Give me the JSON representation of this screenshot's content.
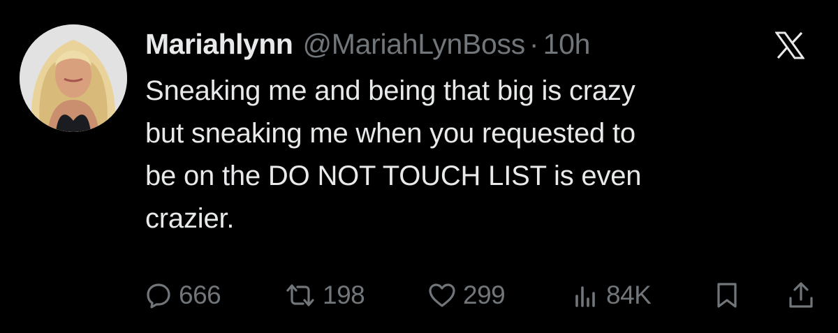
{
  "tweet": {
    "display_name": "Mariahlynn",
    "handle": "@MariahLynBoss",
    "separator": "·",
    "timestamp": "10h",
    "text_lines": [
      "Sneaking me and being that big is crazy",
      "but sneaking me when you requested to",
      "be on the DO NOT TOUCH LIST is even",
      "crazier."
    ]
  },
  "metrics": {
    "replies": "666",
    "reposts": "198",
    "likes": "299",
    "views": "84K"
  },
  "icons": {
    "brand": "x-logo-icon",
    "reply": "reply-icon",
    "repost": "repost-icon",
    "like": "like-icon",
    "views": "views-icon",
    "bookmark": "bookmark-icon",
    "share": "share-icon"
  },
  "colors": {
    "background": "#000000",
    "primary_text": "#e7e9ea",
    "secondary_text": "#71767b"
  }
}
